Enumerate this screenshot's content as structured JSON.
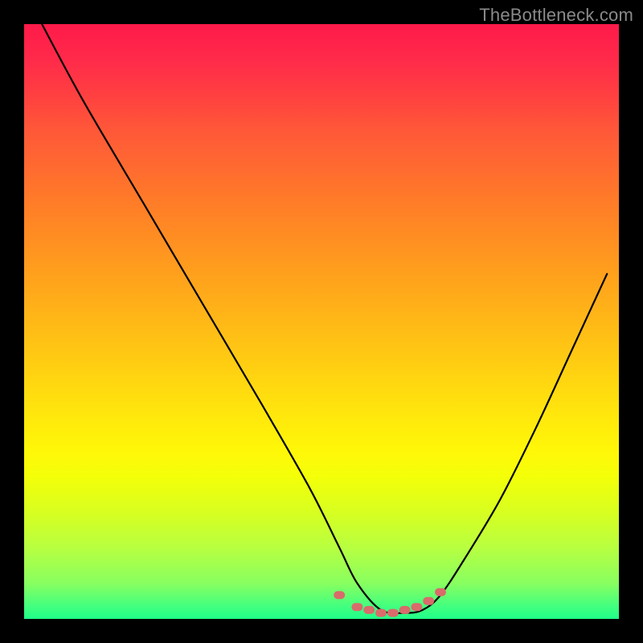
{
  "watermark": "TheBottleneck.com",
  "chart_data": {
    "type": "line",
    "title": "",
    "xlabel": "",
    "ylabel": "",
    "xlim": [
      0,
      100
    ],
    "ylim": [
      0,
      100
    ],
    "grid": false,
    "legend": false,
    "series": [
      {
        "name": "bottleneck-curve",
        "color": "#000000",
        "x": [
          3,
          10,
          20,
          30,
          40,
          48,
          53,
          56,
          60,
          64,
          67,
          70,
          74,
          80,
          86,
          92,
          98
        ],
        "y": [
          100,
          87,
          70,
          53,
          36,
          22,
          12,
          6,
          1.5,
          1,
          1.5,
          4,
          10,
          20,
          32,
          45,
          58
        ]
      },
      {
        "name": "flat-region-markers",
        "color": "#d96b6b",
        "x": [
          53,
          56,
          58,
          60,
          62,
          64,
          66,
          68,
          70
        ],
        "y": [
          4,
          2,
          1.5,
          1,
          1,
          1.5,
          2,
          3,
          4.5
        ]
      }
    ],
    "colors": {
      "background_top": "#ff1a4a",
      "background_bottom": "#20ff88",
      "frame": "#000000",
      "watermark": "#8a8a8a",
      "marker": "#d96b6b"
    }
  }
}
